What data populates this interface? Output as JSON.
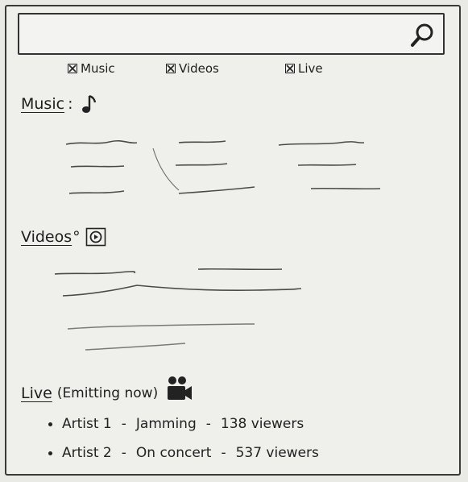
{
  "search": {
    "placeholder": "",
    "icon": "search-icon"
  },
  "filters": [
    {
      "label": "Music",
      "checked": true
    },
    {
      "label": "Videos",
      "checked": true
    },
    {
      "label": "Live",
      "checked": true
    }
  ],
  "music": {
    "title": "Music",
    "suffix": ":",
    "icon": "music-note-icon"
  },
  "videos": {
    "title": "Videos",
    "suffix": "°",
    "icon": "video-play-icon"
  },
  "live": {
    "title": "Live",
    "subtitle": "(Emitting now)",
    "icon": "video-camera-icon",
    "items": [
      {
        "artist": "Artist 1",
        "activity": "Jamming",
        "viewers": "138 viewers"
      },
      {
        "artist": "Artist 2",
        "activity": "On concert",
        "viewers": "537 viewers"
      }
    ]
  },
  "colors": {
    "paper": "#efefec",
    "ink": "#222222"
  }
}
